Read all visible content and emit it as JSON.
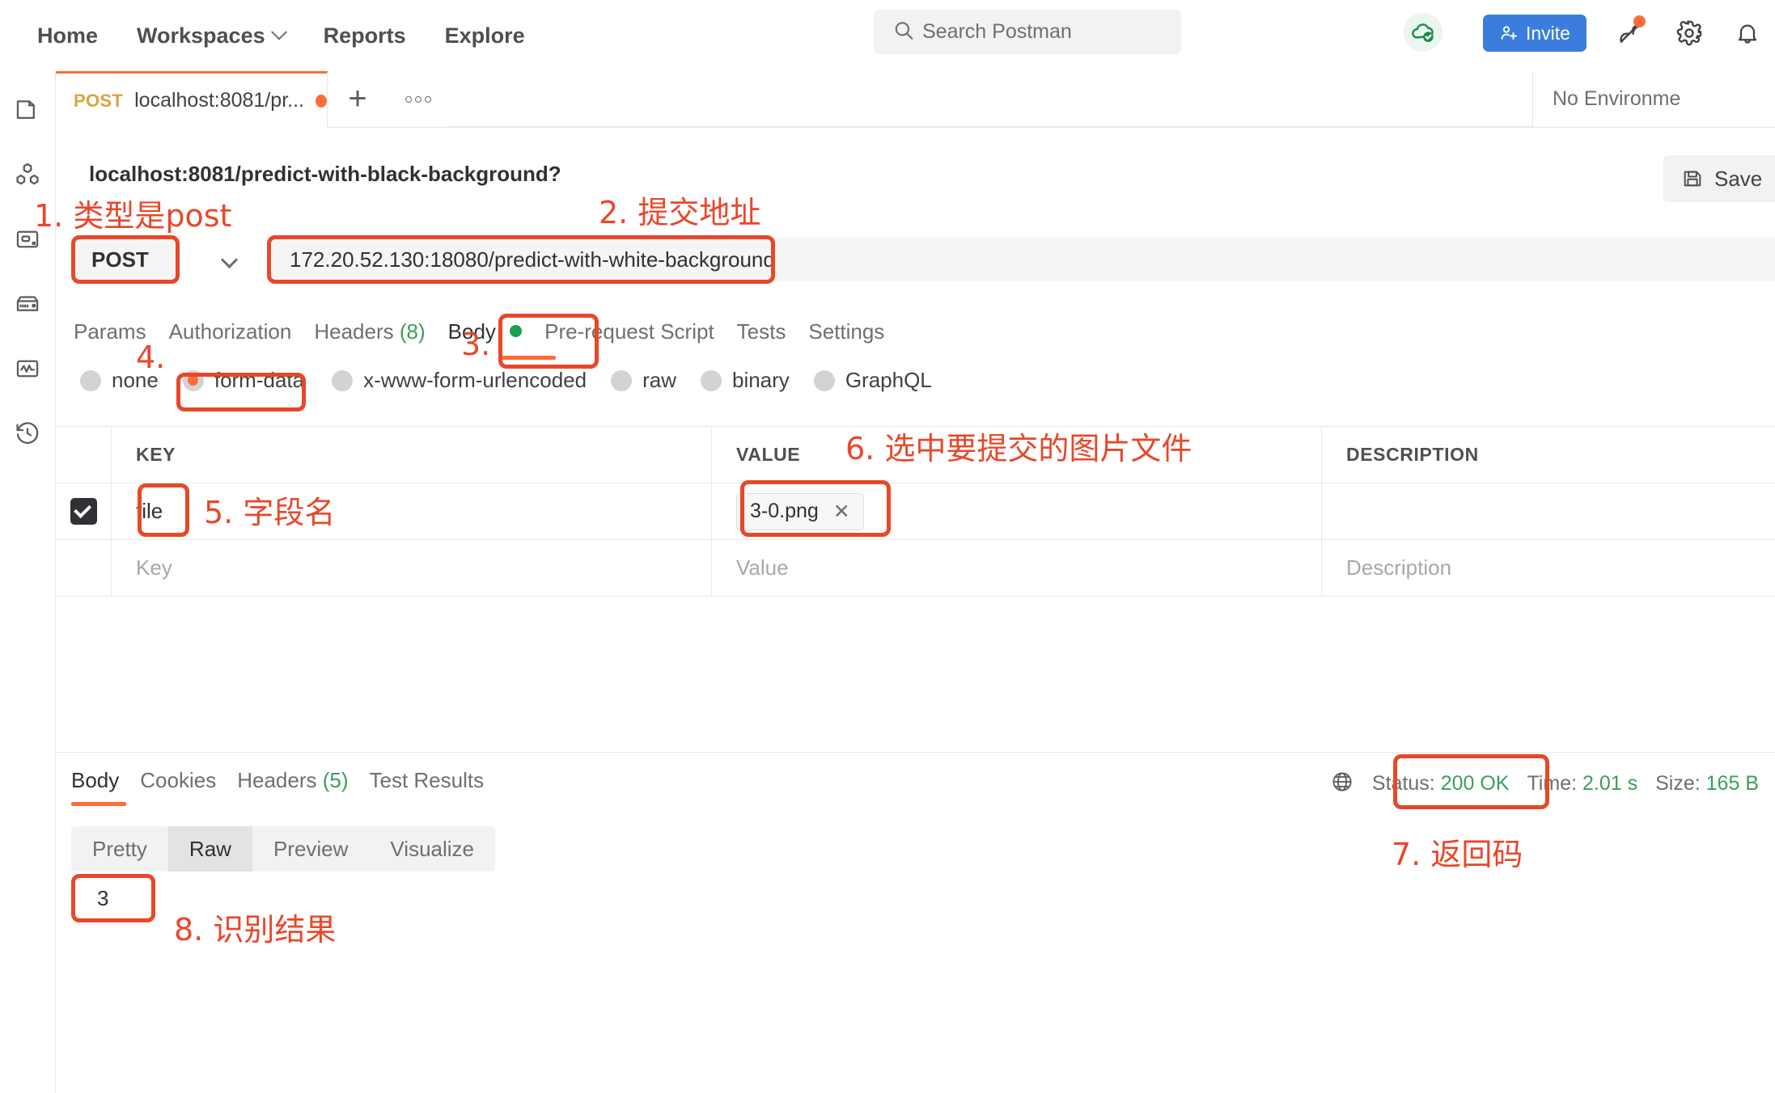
{
  "topnav": {
    "links": [
      {
        "label": "Home",
        "has_chevron": false
      },
      {
        "label": "Workspaces",
        "has_chevron": true
      },
      {
        "label": "Reports",
        "has_chevron": false
      },
      {
        "label": "Explore",
        "has_chevron": false
      }
    ],
    "search_placeholder": "Search Postman",
    "invite_label": "Invite",
    "icons": [
      "cloud-sync-icon",
      "invite-icon",
      "satellite-icon",
      "gear-icon",
      "bell-icon"
    ]
  },
  "rail": {
    "items": [
      {
        "name": "collections-icon"
      },
      {
        "name": "apis-icon"
      },
      {
        "name": "environments-icon"
      },
      {
        "name": "mock-servers-icon"
      },
      {
        "name": "monitors-icon"
      },
      {
        "name": "history-icon"
      }
    ]
  },
  "tabstrip": {
    "tab": {
      "method": "POST",
      "name": "localhost:8081/pr...",
      "unsaved": true
    },
    "new_tab_label": "+",
    "environment_selector": "No Environme"
  },
  "request": {
    "title": "localhost:8081/predict-with-black-background?",
    "save_label": "Save",
    "method": "POST",
    "url": "172.20.52.130:18080/predict-with-white-background",
    "tabs": [
      {
        "label": "Params",
        "active": false
      },
      {
        "label": "Authorization",
        "active": false
      },
      {
        "label": "Headers",
        "count": "(8)",
        "active": false
      },
      {
        "label": "Body",
        "active": true,
        "dot": true
      },
      {
        "label": "Pre-request Script",
        "active": false
      },
      {
        "label": "Tests",
        "active": false
      },
      {
        "label": "Settings",
        "active": false
      }
    ],
    "body_types": [
      {
        "label": "none",
        "selected": false
      },
      {
        "label": "form-data",
        "selected": true
      },
      {
        "label": "x-www-form-urlencoded",
        "selected": false
      },
      {
        "label": "raw",
        "selected": false
      },
      {
        "label": "binary",
        "selected": false
      },
      {
        "label": "GraphQL",
        "selected": false
      }
    ],
    "table": {
      "headers": [
        "KEY",
        "VALUE",
        "DESCRIPTION"
      ],
      "rows": [
        {
          "checked": true,
          "key": "file",
          "value": "3-0.png",
          "value_is_file": true,
          "description": ""
        }
      ],
      "placeholder_row": {
        "key": "Key",
        "value": "Value",
        "description": "Description"
      }
    }
  },
  "response": {
    "tabs": [
      {
        "label": "Body",
        "active": true
      },
      {
        "label": "Cookies",
        "active": false
      },
      {
        "label": "Headers",
        "count": "(5)",
        "active": false
      },
      {
        "label": "Test Results",
        "active": false
      }
    ],
    "view_modes": [
      {
        "label": "Pretty",
        "active": false
      },
      {
        "label": "Raw",
        "active": true
      },
      {
        "label": "Preview",
        "active": false
      },
      {
        "label": "Visualize",
        "active": false
      }
    ],
    "status_label": "Status:",
    "status_value": "200 OK",
    "time_label": "Time:",
    "time_value": "2.01 s",
    "size_label": "Size:",
    "size_value": "165 B",
    "globe_icon": "globe-icon",
    "body_text": "3"
  },
  "annotations": [
    {
      "id": "a1",
      "text": "1. 类型是post"
    },
    {
      "id": "a2",
      "text": "2. 提交地址"
    },
    {
      "id": "a3",
      "text": "3."
    },
    {
      "id": "a4",
      "text": "4."
    },
    {
      "id": "a5",
      "text": "5. 字段名"
    },
    {
      "id": "a6",
      "text": "6. 选中要提交的图片文件"
    },
    {
      "id": "a7",
      "text": "7. 返回码"
    },
    {
      "id": "a8",
      "text": "8. 识别结果"
    }
  ],
  "colors": {
    "accent_orange": "#ff6c37",
    "annotation_red": "#e8472a",
    "invite_blue": "#3b7ddd",
    "success_green": "#3a9e5c"
  }
}
